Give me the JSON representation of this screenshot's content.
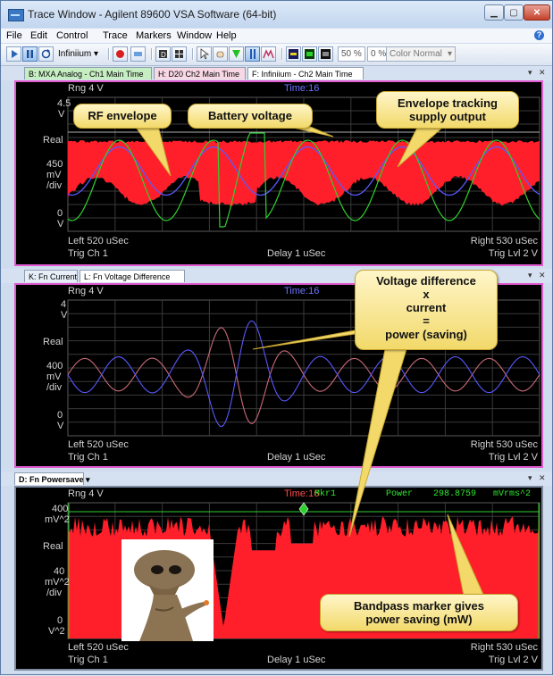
{
  "window": {
    "title": "Trace Window - Agilent 89600 VSA Software (64-bit)",
    "min_icon": "minimize-icon",
    "max_icon": "maximize-icon",
    "close_icon": "close-icon",
    "min_glyph": "▁",
    "max_glyph": "▢",
    "close_glyph": "✕"
  },
  "menu": [
    "File",
    "Edit",
    "Control",
    "Trace",
    "Markers",
    "Window",
    "Help"
  ],
  "toolbar": {
    "source": "Infiniium",
    "zoom1": "50 %",
    "zoom2": "0 %",
    "color_mode": "Color Normal"
  },
  "panel1": {
    "tabs": [
      "B: MXA Analog - Ch1 Main Time",
      "H: D20 Ch2 Main Time",
      "F: Infiniium - Ch2 Main Time"
    ],
    "range": "Rng 4  V",
    "time": "Time:16",
    "y_top": "4.5",
    "y_top_unit": "V",
    "y_real": "Real",
    "y_scale": "450",
    "y_scale_unit1": "mV",
    "y_scale_unit2": "/div",
    "y_bottom": "0",
    "y_bottom_unit": "V",
    "left": "Left 520 uSec",
    "trig": "Trig Ch 1",
    "delay": "Delay 1 uSec",
    "right": "Right 530 uSec",
    "trig_lvl": "Trig Lvl 2  V"
  },
  "panel2": {
    "tabs": [
      "K: Fn Current",
      "L: Fn Voltage Difference"
    ],
    "range": "Rng 4  V",
    "time": "Time:16",
    "y_top": "4",
    "y_top_unit": "V",
    "y_real": "Real",
    "y_scale": "400",
    "y_scale_unit1": "mV",
    "y_scale_unit2": "/div",
    "y_bottom": "0",
    "y_bottom_unit": "V",
    "left": "Left 520 uSec",
    "trig": "Trig Ch 1",
    "delay": "Delay 1 uSec",
    "right": "Right 530 uSec",
    "trig_lvl": "Trig Lvl 2  V"
  },
  "panel3": {
    "tabs": [
      "D: Fn Powersave"
    ],
    "range": "Rng 4  V",
    "time": "Time:16",
    "marker_name": "Mkr1",
    "marker_label": "Power",
    "marker_value": "298.8759",
    "marker_unit": "mVrms^2",
    "y_top": "400",
    "y_top_unit": "mV^2",
    "y_real": "Real",
    "y_scale": "40",
    "y_scale_unit1": "mV^2",
    "y_scale_unit2": "/div",
    "y_bottom": "0",
    "y_bottom_unit": "V^2",
    "left": "Left 520 uSec",
    "trig": "Trig Ch 1",
    "delay": "Delay 1 uSec",
    "right": "Right 530 uSec",
    "trig_lvl": "Trig Lvl 2  V"
  },
  "callouts": {
    "rf_envelope": "RF envelope",
    "battery": "Battery voltage",
    "env_line1": "Envelope tracking",
    "env_line2": "supply output",
    "vd_line1": "Voltage difference",
    "vd_line2": "x",
    "vd_line3": "current",
    "vd_line4": "=",
    "vd_line5": "power (saving)",
    "bp_line1": "Bandpass marker gives",
    "bp_line2": "power saving (mW)"
  },
  "colors": {
    "trace_red": "#ff1f2a",
    "trace_green": "#2fd12f",
    "trace_violet": "#5a58ff",
    "trace_pink": "#c96a7a",
    "active_border": "#e05bd0",
    "time_label": "#6e74ff"
  }
}
